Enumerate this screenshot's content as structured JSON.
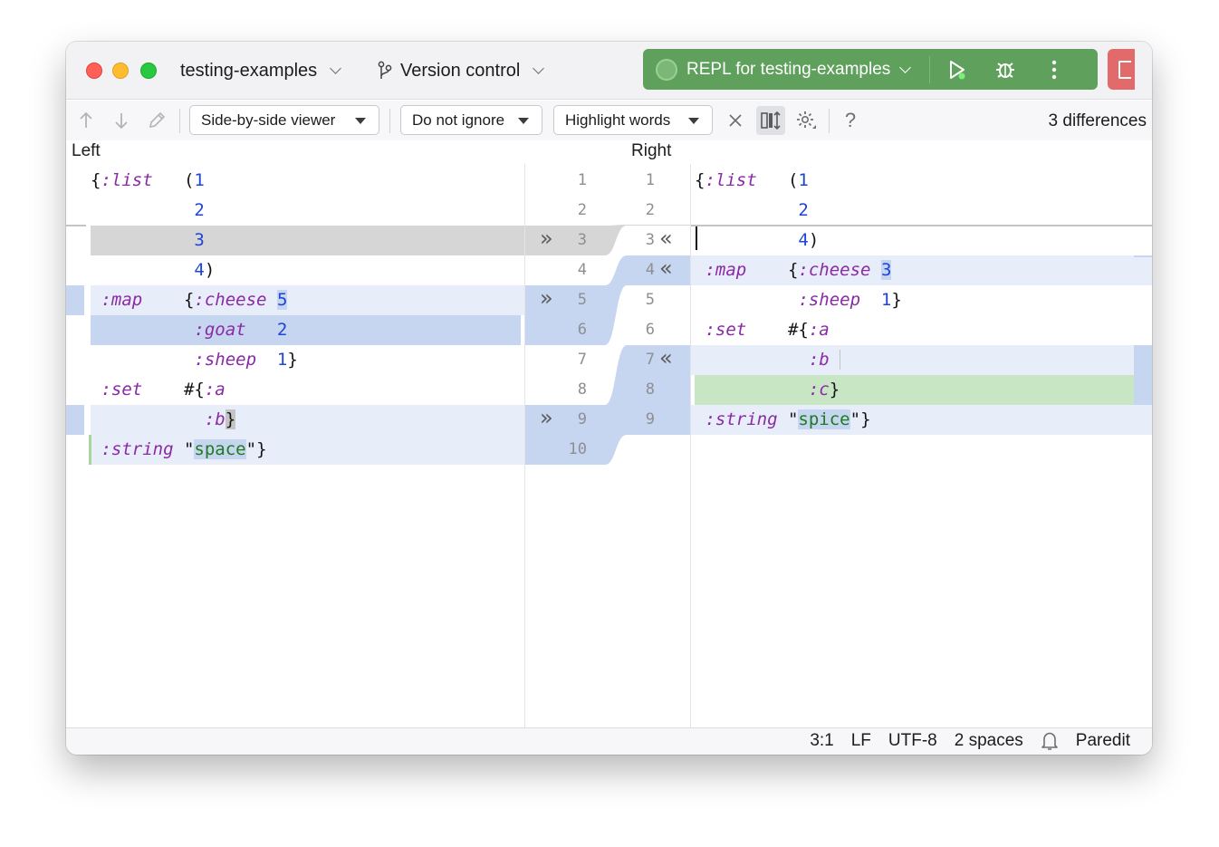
{
  "titlebar": {
    "project": "testing-examples",
    "vcs": "Version control",
    "run_config": "REPL for testing-examples",
    "icons": [
      "branch-icon",
      "play-icon",
      "debug-icon",
      "more-icon",
      "stop-icon"
    ]
  },
  "toolbar": {
    "viewer": "Side-by-side viewer",
    "ignore": "Do not ignore",
    "highlight": "Highlight words",
    "diff_count": "3 differences",
    "help": "?"
  },
  "panes": {
    "left_title": "Left",
    "right_title": "Right"
  },
  "left_lines": [
    "{:list   (1",
    "          2",
    "          3",
    "          4)",
    " :map    {:cheese 5",
    "          :goat   2",
    "          :sheep  1}",
    " :set    #{:a",
    "           :b}",
    " :string \"space\"}"
  ],
  "right_lines": [
    "{:list   (1",
    "          2",
    "          4)",
    " :map    {:cheese 3",
    "          :sheep  1}",
    " :set    #{:a",
    "           :b",
    "           :c}",
    " :string \"spice\"}"
  ],
  "gutter": {
    "left_numbers": [
      "1",
      "2",
      "3",
      "4",
      "5",
      "6",
      "7",
      "8",
      "9",
      "10"
    ],
    "right_numbers": [
      "1",
      "2",
      "3",
      "4",
      "5",
      "6",
      "7",
      "8",
      "9"
    ],
    "left_arrows": "»",
    "right_arrows": "«"
  },
  "status": {
    "position": "3:1",
    "line_sep": "LF",
    "encoding": "UTF-8",
    "indent": "2 spaces",
    "mode": "Paredit"
  },
  "colors": {
    "run_widget": "#5fa05c",
    "change_bg": "#e8eef9",
    "change_word": "#c6d6f0",
    "deleted_bg": "#d6d6d6",
    "added_bg": "#c8e6c4",
    "keyword": "#8a2aa6",
    "number": "#1e44d8",
    "string": "#1e7a1e"
  }
}
